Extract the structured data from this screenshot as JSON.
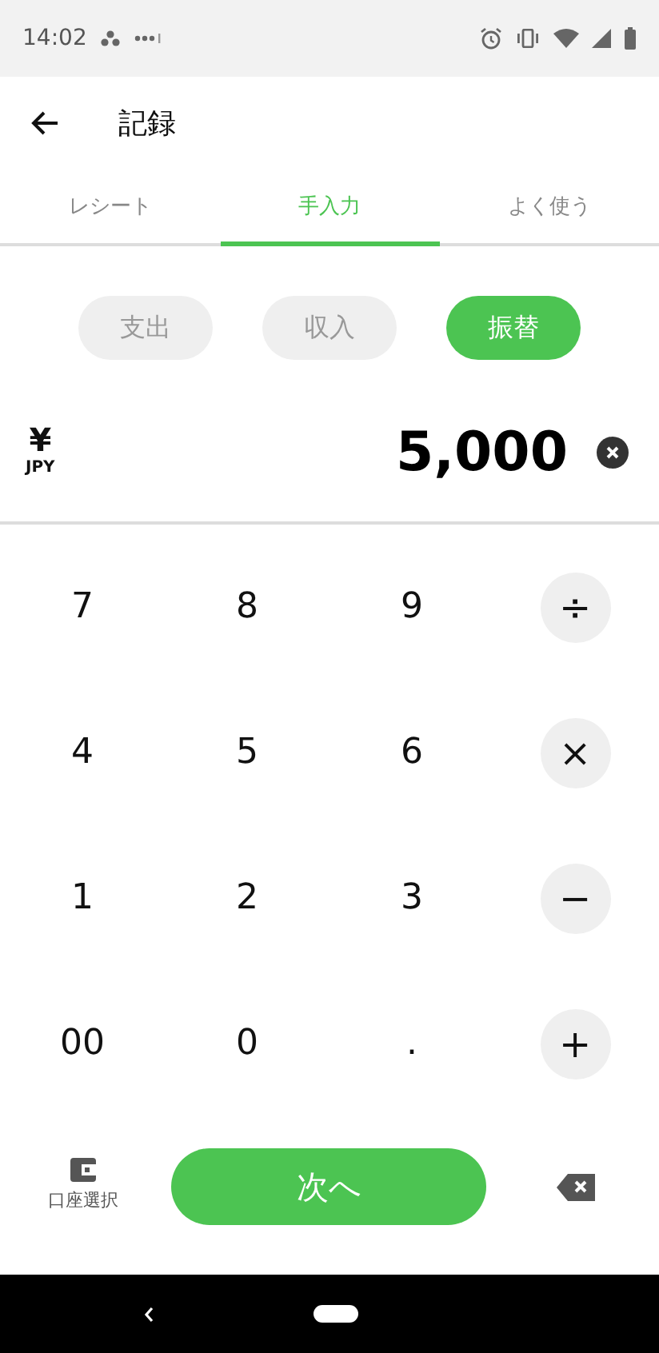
{
  "status_bar": {
    "time": "14:02"
  },
  "header": {
    "title": "記録"
  },
  "tabs": [
    {
      "label": "レシート",
      "selected": false
    },
    {
      "label": "手入力",
      "selected": true
    },
    {
      "label": "よく使う",
      "selected": false
    }
  ],
  "type_buttons": [
    {
      "label": "支出",
      "selected": false
    },
    {
      "label": "収入",
      "selected": false
    },
    {
      "label": "振替",
      "selected": true
    }
  ],
  "amount": {
    "currency_symbol": "¥",
    "currency_code": "JPY",
    "value": "5,000"
  },
  "keypad": [
    [
      {
        "label": "7",
        "kind": "digit"
      },
      {
        "label": "8",
        "kind": "digit"
      },
      {
        "label": "9",
        "kind": "digit"
      },
      {
        "label": "÷",
        "kind": "operator"
      }
    ],
    [
      {
        "label": "4",
        "kind": "digit"
      },
      {
        "label": "5",
        "kind": "digit"
      },
      {
        "label": "6",
        "kind": "digit"
      },
      {
        "label": "×",
        "kind": "operator"
      }
    ],
    [
      {
        "label": "1",
        "kind": "digit"
      },
      {
        "label": "2",
        "kind": "digit"
      },
      {
        "label": "3",
        "kind": "digit"
      },
      {
        "label": "−",
        "kind": "operator"
      }
    ],
    [
      {
        "label": "00",
        "kind": "digit"
      },
      {
        "label": "0",
        "kind": "digit"
      },
      {
        "label": ".",
        "kind": "digit"
      },
      {
        "label": "+",
        "kind": "operator"
      }
    ]
  ],
  "account_button": {
    "label": "口座選択"
  },
  "next_button": {
    "label": "次へ"
  }
}
